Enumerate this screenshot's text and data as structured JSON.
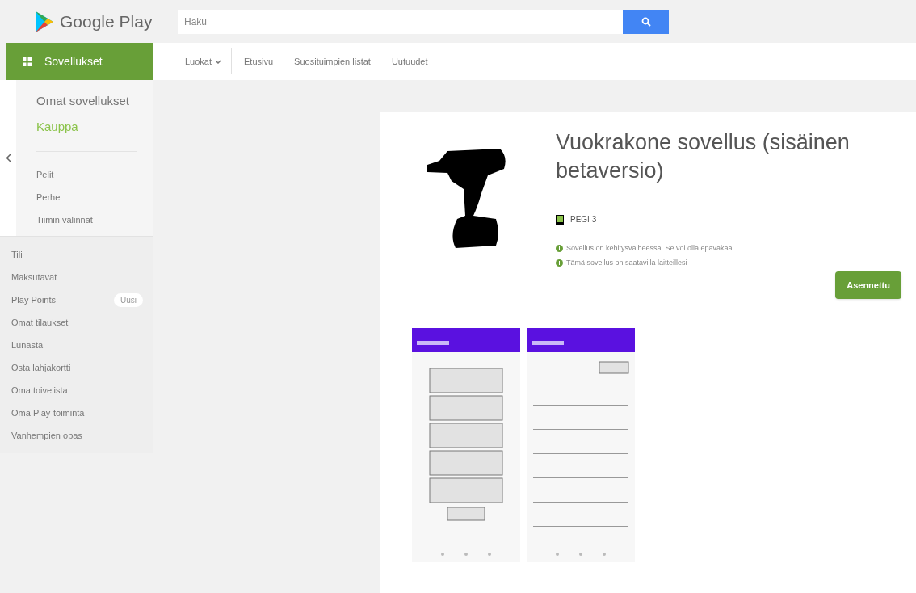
{
  "header": {
    "logo_text": "Google Play",
    "search": {
      "placeholder": "Haku"
    }
  },
  "nav": {
    "section": "Sovellukset",
    "tabs": [
      {
        "label": "Luokat",
        "kind": "dropdown"
      },
      {
        "label": "Etusivu",
        "kind": "link"
      },
      {
        "label": "Suosituimpien listat",
        "kind": "link"
      },
      {
        "label": "Uutuudet",
        "kind": "link"
      }
    ]
  },
  "sidebar": {
    "top_items": [
      {
        "label": "Omat sovellukset",
        "selected": false
      },
      {
        "label": "Kauppa",
        "selected": true
      }
    ],
    "categories": [
      "Pelit",
      "Perhe",
      "Tiimin valinnat"
    ],
    "links": [
      {
        "label": "Tili"
      },
      {
        "label": "Maksutavat"
      },
      {
        "label": "Play Points",
        "badge": "Uusi"
      },
      {
        "label": "Omat tilaukset"
      },
      {
        "label": "Lunasta"
      },
      {
        "label": "Osta lahjakortti"
      },
      {
        "label": "Oma toivelista"
      },
      {
        "label": "Oma Play-toiminta"
      },
      {
        "label": "Vanhempien opas"
      }
    ]
  },
  "app": {
    "title": "Vuokrakone sovellus (sisäinen betaversio)",
    "rating": "PEGI 3",
    "notices": [
      "Sovellus on kehitysvaiheessa. Se voi olla epävakaa.",
      "Tämä sovellus on saatavilla laitteillesi"
    ],
    "install_button": "Asennettu",
    "screenshots": [
      {
        "kind": "picture"
      },
      {
        "kind": "picture"
      }
    ]
  }
}
